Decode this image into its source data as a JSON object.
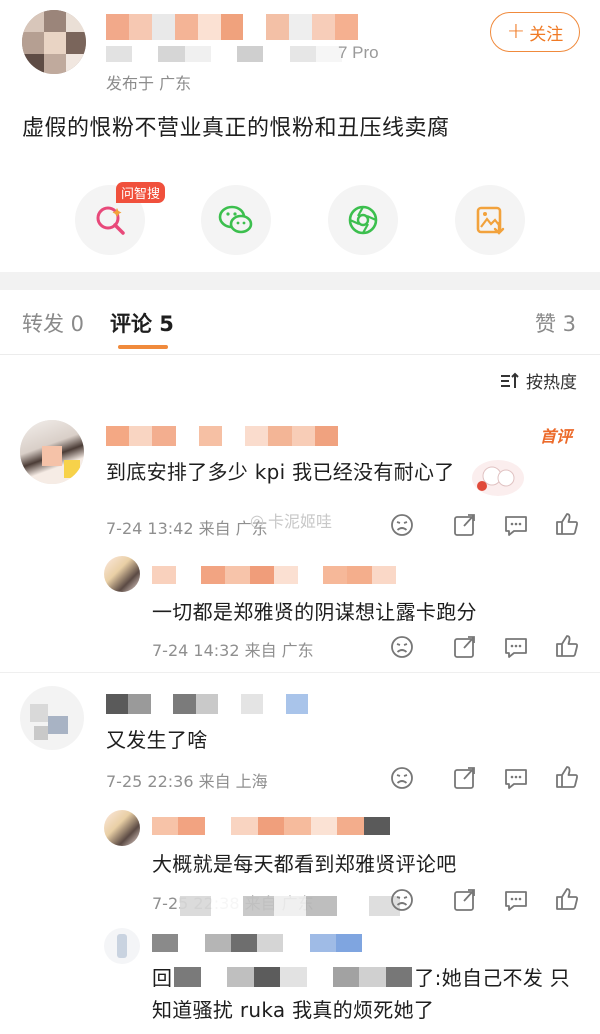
{
  "post": {
    "device_suffix": "7 Pro",
    "location": "发布于 广东",
    "follow_label": "关注",
    "text": "虚假的恨粉不营业真正的恨粉和丑压线卖腐"
  },
  "share": {
    "badge": "问智搜",
    "buttons": [
      "ask-search-icon",
      "wechat-icon",
      "moments-icon",
      "save-image-icon"
    ]
  },
  "tabs": {
    "repost": "转发 0",
    "comments": "评论 5",
    "likes": "赞 3"
  },
  "sort": {
    "label": "按热度"
  },
  "comments": [
    {
      "hot_badge": "首评",
      "text": "到底安排了多少 kpi 我已经没有耐心了",
      "meta": "7-24 13:42  来自 广东",
      "replies": [
        {
          "text": "一切都是郑雅贤的阴谋想让露卡跑分",
          "meta": "7-24 14:32  来自 广东"
        }
      ]
    },
    {
      "text": "又发生了啥",
      "meta": "7-25 22:36  来自 上海",
      "replies": [
        {
          "text": "大概就是每天都看到郑雅贤评论吧",
          "meta": "7-25 22:38  来自 广东"
        },
        {
          "text_prefix": "回",
          "text_suffix": "了:她自己不发 只",
          "text_line2": "知道骚扰 ruka 我真的烦死她了"
        }
      ]
    }
  ],
  "watermark": "卡泥姬哇",
  "colors": {
    "accent": "#f08a3c",
    "hot": "#ec6a2a",
    "badge": "#f0503c"
  }
}
